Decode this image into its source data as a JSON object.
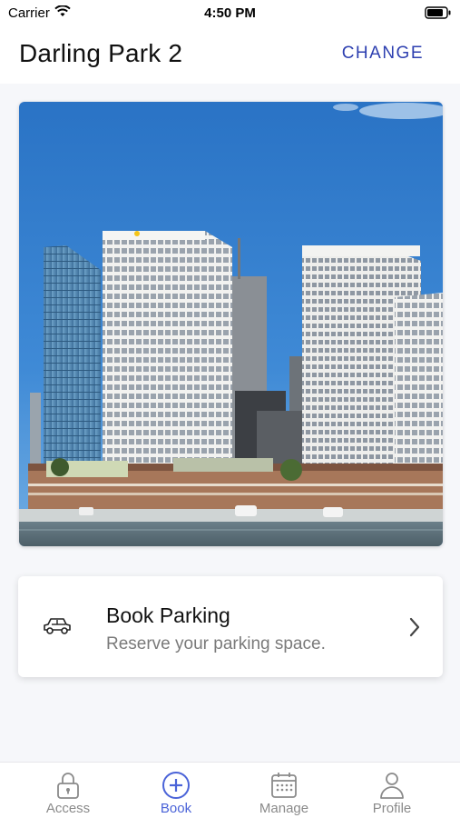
{
  "status_bar": {
    "carrier": "Carrier",
    "time": "4:50 PM",
    "icons": [
      "wifi-icon",
      "battery-icon"
    ]
  },
  "header": {
    "title": "Darling Park 2",
    "change_label": "CHANGE"
  },
  "hero_image": {
    "subject": "building-photo"
  },
  "book_card": {
    "title": "Book Parking",
    "subtitle": "Reserve your parking space.",
    "icon": "car-icon"
  },
  "tabs": [
    {
      "label": "Access",
      "icon": "lock-icon",
      "active": false
    },
    {
      "label": "Book",
      "icon": "plus-circle-icon",
      "active": true
    },
    {
      "label": "Manage",
      "icon": "calendar-icon",
      "active": false
    },
    {
      "label": "Profile",
      "icon": "person-icon",
      "active": false
    }
  ],
  "colors": {
    "accent": "#2d3fb0",
    "tab_active": "#4a63d8",
    "tab_inactive": "#8a8a8a",
    "background": "#f6f7fa"
  }
}
